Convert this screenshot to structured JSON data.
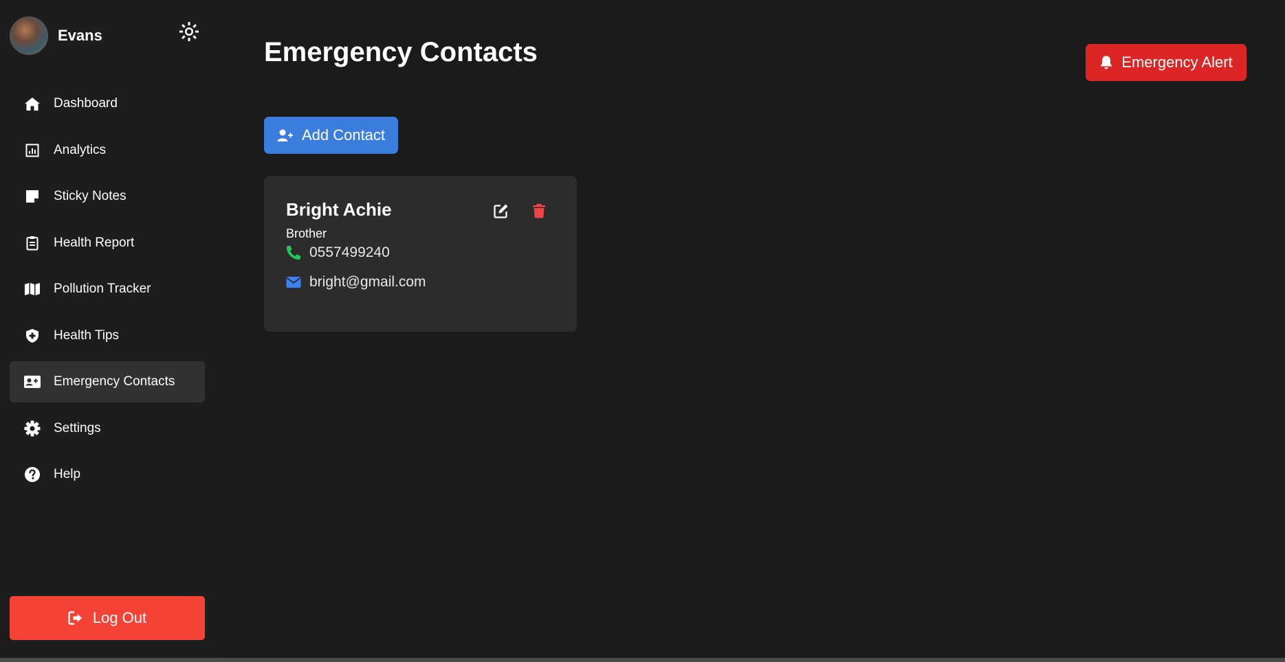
{
  "user": {
    "name": "Evans"
  },
  "sidebar": {
    "items": [
      {
        "label": "Dashboard",
        "icon": "home-icon"
      },
      {
        "label": "Analytics",
        "icon": "analytics-icon"
      },
      {
        "label": "Sticky Notes",
        "icon": "sticky-note-icon"
      },
      {
        "label": "Health Report",
        "icon": "clipboard-icon"
      },
      {
        "label": "Pollution Tracker",
        "icon": "map-icon"
      },
      {
        "label": "Health Tips",
        "icon": "shield-plus-icon"
      },
      {
        "label": "Emergency Contacts",
        "icon": "contact-card-icon",
        "active": true
      },
      {
        "label": "Settings",
        "icon": "gear-icon"
      },
      {
        "label": "Help",
        "icon": "help-icon"
      }
    ],
    "logout_label": "Log Out"
  },
  "main": {
    "title": "Emergency Contacts",
    "alert_label": "Emergency Alert",
    "add_label": "Add Contact"
  },
  "contacts": [
    {
      "name": "Bright Achie",
      "relation": "Brother",
      "phone": "0557499240",
      "email": "bright@gmail.com"
    }
  ],
  "colors": {
    "background": "#1b1b1b",
    "card": "#2c2c2c",
    "alert": "#dc2626",
    "logout": "#f44336",
    "primary": "#3b7ddd",
    "phone_icon": "#22c55e",
    "email_icon": "#3b82f6",
    "delete_icon": "#ef4444"
  }
}
